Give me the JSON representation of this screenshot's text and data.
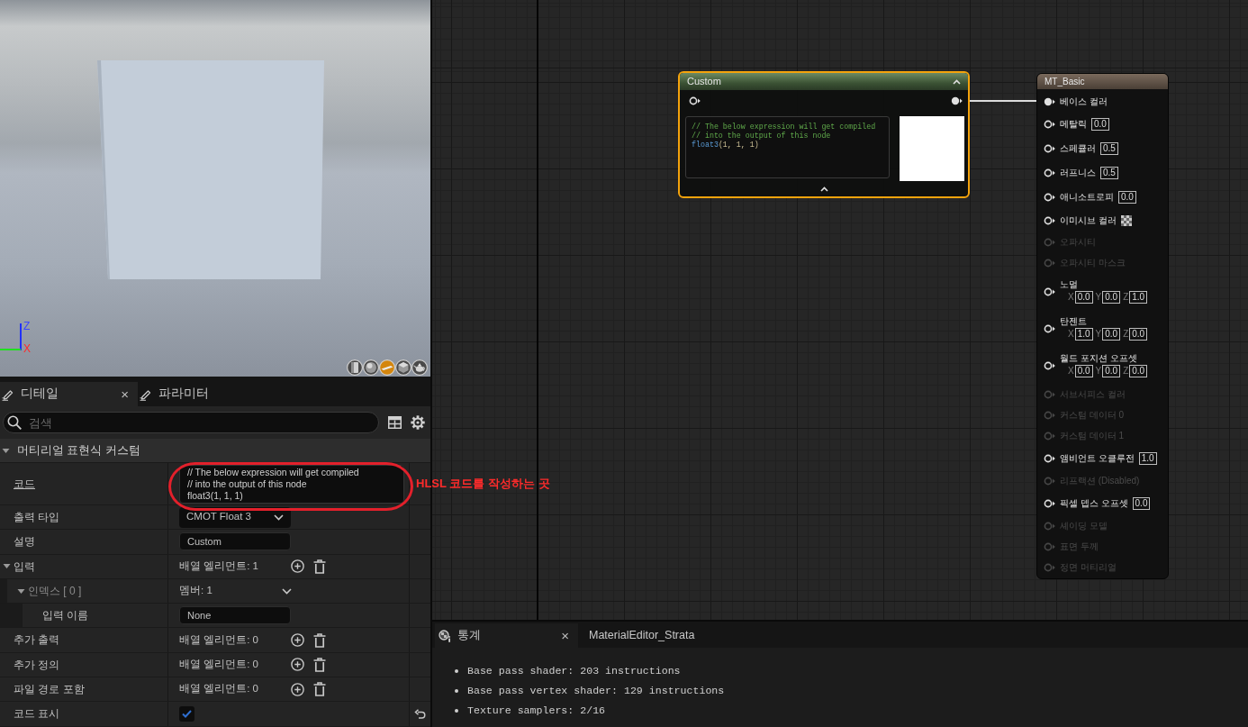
{
  "viewport": {
    "axes": [
      {
        "label": "Z",
        "color": "#3a46ff"
      },
      {
        "label": "X",
        "color": "#ff2a2a"
      }
    ],
    "preview_shapes": [
      {
        "kind": "cylinder",
        "selected": false
      },
      {
        "kind": "sphere",
        "selected": false
      },
      {
        "kind": "plane",
        "selected": true
      },
      {
        "kind": "cube",
        "selected": false
      },
      {
        "kind": "teapot",
        "selected": false
      }
    ]
  },
  "details": {
    "tabs": [
      {
        "label": "디테일",
        "selected": true,
        "close": "×"
      },
      {
        "label": "파라미터",
        "selected": false
      }
    ],
    "search": {
      "placeholder": "검색"
    },
    "section": {
      "title": "머티리얼 표현식 커스텀",
      "expanded": true
    },
    "rows": [
      {
        "kind": "code",
        "label": "코드",
        "underlined": true,
        "resettable": false,
        "value": "// The below expression will get compiled\n// into the output of this node\nfloat3(1, 1, 1)"
      },
      {
        "kind": "dropdown",
        "label": "출력 타입",
        "underlined": false,
        "resettable": false,
        "value": "CMOT Float 3"
      },
      {
        "kind": "text",
        "label": "설명",
        "underlined": false,
        "resettable": false,
        "value": "Custom"
      },
      {
        "kind": "array",
        "label": "입력",
        "underlined": false,
        "resettable": false,
        "value": "배열 엘리먼트: 1",
        "expanded": true,
        "children": [
          {
            "kind": "struct",
            "label": "인덱스 [ 0 ]",
            "underlined": false,
            "resettable": false,
            "value": "멤버: 1",
            "expanded": true,
            "children": [
              {
                "kind": "text",
                "label": "입력 이름",
                "underlined": false,
                "resettable": false,
                "value": "None"
              }
            ]
          }
        ]
      },
      {
        "kind": "array",
        "label": "추가 출력",
        "underlined": false,
        "resettable": false,
        "value": "배열 엘리먼트: 0"
      },
      {
        "kind": "array",
        "label": "추가 정의",
        "underlined": false,
        "resettable": false,
        "value": "배열 엘리먼트: 0"
      },
      {
        "kind": "array",
        "label": "파일 경로 포함",
        "underlined": false,
        "resettable": false,
        "value": "배열 엘리먼트: 0"
      },
      {
        "kind": "checkbox",
        "label": "코드 표시",
        "underlined": false,
        "resettable": true,
        "checked": true
      }
    ]
  },
  "annotation": {
    "text": "HLSL 코드를 작성하는 곳"
  },
  "graph": {
    "custom_node": {
      "title": "Custom",
      "selected": true,
      "input_pin": {
        "connected": false
      },
      "output_pin": {
        "connected": true
      },
      "code_lines": [
        [
          {
            "kind": "comment",
            "text": "// The below expression will get compiled"
          }
        ],
        [
          {
            "kind": "comment",
            "text": "// into the output of this node"
          }
        ],
        [
          {
            "kind": "function",
            "text": "float3"
          },
          {
            "kind": "literal",
            "text": "(1, 1, 1)"
          }
        ]
      ]
    },
    "material_node": {
      "title": "MT_Basic",
      "pins": [
        {
          "kind": "plain",
          "label": "베이스 컬러",
          "enabled": true,
          "connected": true
        },
        {
          "kind": "scalar",
          "label": "메탈릭",
          "enabled": true,
          "connected": false,
          "value": "0.0"
        },
        {
          "kind": "scalar",
          "label": "스페큘러",
          "enabled": true,
          "connected": false,
          "value": "0.5"
        },
        {
          "kind": "scalar",
          "label": "러프니스",
          "enabled": true,
          "connected": false,
          "value": "0.5"
        },
        {
          "kind": "scalar",
          "label": "애니소트로피",
          "enabled": true,
          "connected": false,
          "value": "0.0"
        },
        {
          "kind": "texture",
          "label": "이미시브 컬러",
          "enabled": true,
          "connected": false
        },
        {
          "kind": "plain",
          "label": "오파시티",
          "enabled": false,
          "connected": false
        },
        {
          "kind": "plain",
          "label": "오파시티 마스크",
          "enabled": false,
          "connected": false
        },
        {
          "kind": "vector",
          "label": "노멀",
          "enabled": true,
          "connected": false,
          "values": [
            {
              "axis": "X",
              "value": "0.0"
            },
            {
              "axis": "Y",
              "value": "0.0"
            },
            {
              "axis": "Z",
              "value": "1.0"
            }
          ]
        },
        {
          "kind": "vector",
          "label": "탄젠트",
          "enabled": true,
          "connected": false,
          "values": [
            {
              "axis": "X",
              "value": "1.0"
            },
            {
              "axis": "Y",
              "value": "0.0"
            },
            {
              "axis": "Z",
              "value": "0.0"
            }
          ]
        },
        {
          "kind": "vector",
          "label": "월드 포지션 오프셋",
          "enabled": true,
          "connected": false,
          "values": [
            {
              "axis": "X",
              "value": "0.0"
            },
            {
              "axis": "Y",
              "value": "0.0"
            },
            {
              "axis": "Z",
              "value": "0.0"
            }
          ]
        },
        {
          "kind": "plain",
          "label": "서브서피스 컬러",
          "enabled": false,
          "connected": false
        },
        {
          "kind": "plain",
          "label": "커스텀 데이터 0",
          "enabled": false,
          "connected": false
        },
        {
          "kind": "plain",
          "label": "커스텀 데이터 1",
          "enabled": false,
          "connected": false
        },
        {
          "kind": "scalar",
          "label": "앰비언트 오클루전",
          "enabled": true,
          "connected": false,
          "value": "1.0"
        },
        {
          "kind": "plain",
          "label": "리프랙션 (Disabled)",
          "enabled": false,
          "connected": false
        },
        {
          "kind": "scalar",
          "label": "픽셀 뎁스 오프셋",
          "enabled": true,
          "connected": false,
          "value": "0.0"
        },
        {
          "kind": "plain",
          "label": "셰이딩 모델",
          "enabled": false,
          "connected": false
        },
        {
          "kind": "plain",
          "label": "표면 두께",
          "enabled": false,
          "connected": false
        },
        {
          "kind": "plain",
          "label": "정면 머티리얼",
          "enabled": false,
          "connected": false
        }
      ]
    }
  },
  "stats": {
    "tabs": [
      {
        "label": "통계",
        "selected": true,
        "close": "×"
      },
      {
        "label": "MaterialEditor_Strata",
        "selected": false
      }
    ],
    "lines": [
      "Base pass shader: 203 instructions",
      "Base pass vertex shader: 129 instructions",
      "Texture samplers: 2/16"
    ]
  }
}
